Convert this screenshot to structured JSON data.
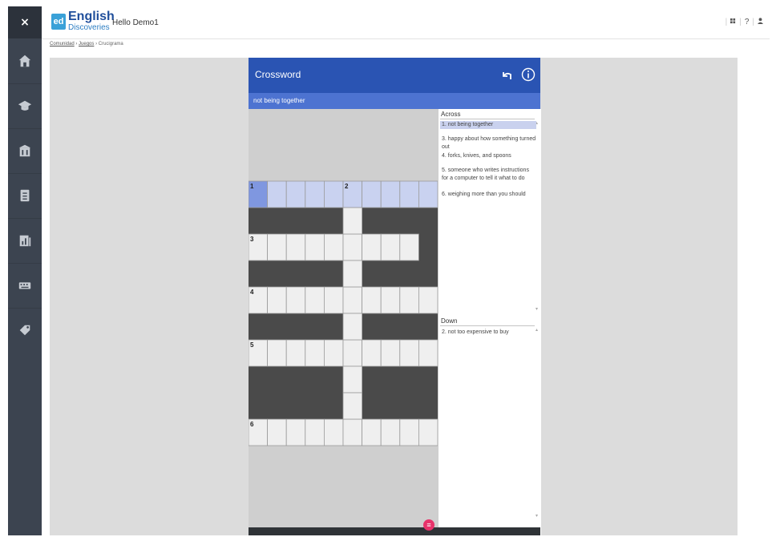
{
  "sidebar": {
    "close_label": "×",
    "items": [
      {
        "icon": "home-icon"
      },
      {
        "icon": "graduation-cap-icon"
      },
      {
        "icon": "building-icon"
      },
      {
        "icon": "notebook-icon"
      },
      {
        "icon": "chart-icon"
      },
      {
        "icon": "keyboard-icon"
      },
      {
        "icon": "tag-icon"
      }
    ]
  },
  "header": {
    "logo_mark": "ed",
    "logo_word": "English",
    "logo_sub": "Discoveries",
    "greeting": "Hello Demo1",
    "right_icons": [
      "grid-icon",
      "help-icon",
      "user-icon"
    ],
    "help_label": "?"
  },
  "breadcrumb": {
    "items": [
      "Comunidad",
      "Juegos",
      "Crucigrama"
    ]
  },
  "crossword": {
    "title": "Crossword",
    "current_clue": "not being together",
    "grid_numbers": [
      "1",
      "2",
      "3",
      "4",
      "5",
      "6"
    ],
    "across_heading": "Across",
    "across": [
      "1. not being together",
      "3. happy about how something turned out",
      "4. forks, knives, and spoons",
      "5. someone who writes instructions for a computer to tell it what to do",
      "6. weighing more than you should"
    ],
    "down_heading": "Down",
    "down": [
      "2. not too expensive to buy"
    ],
    "menu_label": "≡"
  },
  "colors": {
    "sidebar": "#3c4450",
    "header_blue": "#2a54b3",
    "clue_bar": "#4d73d1",
    "active_cell": "#7f97e0",
    "highlight_cell": "#c9d2f0",
    "fab": "#e8336b"
  }
}
